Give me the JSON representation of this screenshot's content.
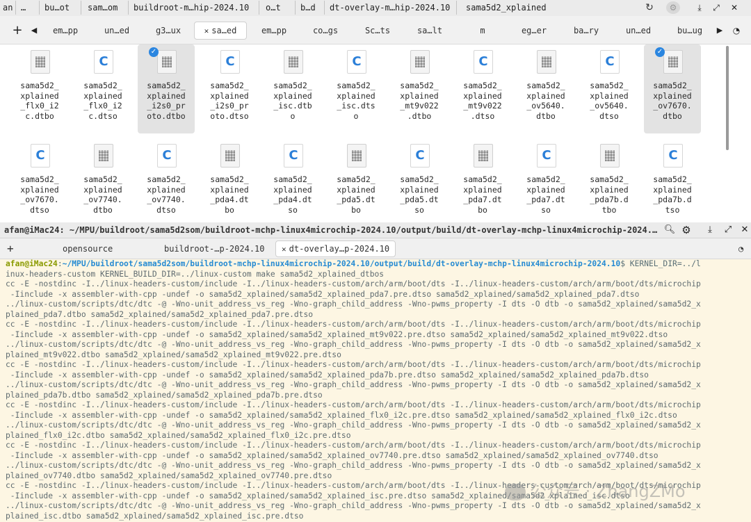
{
  "file_manager": {
    "breadcrumbs": [
      "an",
      "…",
      "bu…ot",
      "sam…om",
      "buildroot-m…hip-2024.10",
      "o…t",
      "b…d",
      "dt-overlay-m…hip-2024.10",
      "sama5d2_xplained"
    ],
    "tabs": [
      "em…pp",
      "un…ed",
      "g3…ux",
      "sa…ed",
      "em…pp",
      "co…gs",
      "Sc…ts",
      "sa…lt",
      "m",
      "eg…er",
      "ba…ry",
      "un…ed",
      "bu…ug"
    ],
    "active_tab_index": 3,
    "files": [
      {
        "name": "sama5d2_\nxplained\n_flx0_i2\nc.dtbo",
        "type": "binary",
        "selected": false
      },
      {
        "name": "sama5d2_\nxplained\n_flx0_i2\nc.dtso",
        "type": "source",
        "selected": false
      },
      {
        "name": "sama5d2_\nxplained\n_i2s0_pr\noto.dtbo",
        "type": "binary",
        "selected": true
      },
      {
        "name": "sama5d2_\nxplained\n_i2s0_pr\noto.dtso",
        "type": "source",
        "selected": false
      },
      {
        "name": "sama5d2_\nxplained\n_isc.dtb\no",
        "type": "binary",
        "selected": false
      },
      {
        "name": "sama5d2_\nxplained\n_isc.dts\no",
        "type": "source",
        "selected": false
      },
      {
        "name": "sama5d2_\nxplained\n_mt9v022\n.dtbo",
        "type": "binary",
        "selected": false
      },
      {
        "name": "sama5d2_\nxplained\n_mt9v022\n.dtso",
        "type": "source",
        "selected": false
      },
      {
        "name": "sama5d2_\nxplained\n_ov5640.\ndtbo",
        "type": "binary",
        "selected": false
      },
      {
        "name": "sama5d2_\nxplained\n_ov5640.\ndtso",
        "type": "source",
        "selected": false
      },
      {
        "name": "sama5d2_\nxplained\n_ov7670.\ndtbo",
        "type": "binary",
        "selected": true
      },
      {
        "name": "sama5d2_\nxplained\n_ov7670.\ndtso",
        "type": "source",
        "selected": false
      },
      {
        "name": "sama5d2_\nxplained\n_ov7740.\ndtbo",
        "type": "binary",
        "selected": false
      },
      {
        "name": "sama5d2_\nxplained\n_ov7740.\ndtso",
        "type": "source",
        "selected": false
      },
      {
        "name": "sama5d2_\nxplained\n_pda4.dt\nbo",
        "type": "binary",
        "selected": false
      },
      {
        "name": "sama5d2_\nxplained\n_pda4.dt\nso",
        "type": "source",
        "selected": false
      },
      {
        "name": "sama5d2_\nxplained\n_pda5.dt\nbo",
        "type": "binary",
        "selected": false
      },
      {
        "name": "sama5d2_\nxplained\n_pda5.dt\nso",
        "type": "source",
        "selected": false
      },
      {
        "name": "sama5d2_\nxplained\n_pda7.dt\nbo",
        "type": "binary",
        "selected": false
      },
      {
        "name": "sama5d2_\nxplained\n_pda7.dt\nso",
        "type": "source",
        "selected": false
      },
      {
        "name": "sama5d2_\nxplained\n_pda7b.d\ntbo",
        "type": "binary",
        "selected": false
      },
      {
        "name": "sama5d2_\nxplained\n_pda7b.d\ntso",
        "type": "source",
        "selected": false
      }
    ]
  },
  "terminal": {
    "title": "afan@iMac24: ~/MPU/buildroot/sama5d2som/buildroot-mchp-linux4microchip-2024.10/output/build/dt-overlay-mchp-linux4microchip-2024.…",
    "tabs": [
      "opensource",
      "buildroot-…p-2024.10",
      "dt-overlay…p-2024.10"
    ],
    "active_tab_index": 2,
    "prompt_user": "afan@iMac24",
    "prompt_path": "~/MPU/buildroot/sama5d2som/buildroot-mchp-linux4microchip-2024.10/output/build/dt-overlay-mchp-linux4microchip-2024.10",
    "prompt_symbol": "$ KERNEL_DIR=../l",
    "lines": [
      "inux-headers-custom KERNEL_BUILD_DIR=../linux-custom make sama5d2_xplained_dtbos",
      "cc -E -nostdinc -I../linux-headers-custom/include -I../linux-headers-custom/arch/arm/boot/dts -I../linux-headers-custom/arch/arm/boot/dts/microchip",
      " -Iinclude -x assembler-with-cpp -undef -o sama5d2_xplained/sama5d2_xplained_pda7.pre.dtso sama5d2_xplained/sama5d2_xplained_pda7.dtso",
      "../linux-custom/scripts/dtc/dtc -@ -Wno-unit_address_vs_reg -Wno-graph_child_address -Wno-pwms_property -I dts -O dtb -o sama5d2_xplained/sama5d2_x",
      "plained_pda7.dtbo sama5d2_xplained/sama5d2_xplained_pda7.pre.dtso",
      "cc -E -nostdinc -I../linux-headers-custom/include -I../linux-headers-custom/arch/arm/boot/dts -I../linux-headers-custom/arch/arm/boot/dts/microchip",
      " -Iinclude -x assembler-with-cpp -undef -o sama5d2_xplained/sama5d2_xplained_mt9v022.pre.dtso sama5d2_xplained/sama5d2_xplained_mt9v022.dtso",
      "../linux-custom/scripts/dtc/dtc -@ -Wno-unit_address_vs_reg -Wno-graph_child_address -Wno-pwms_property -I dts -O dtb -o sama5d2_xplained/sama5d2_x",
      "plained_mt9v022.dtbo sama5d2_xplained/sama5d2_xplained_mt9v022.pre.dtso",
      "cc -E -nostdinc -I../linux-headers-custom/include -I../linux-headers-custom/arch/arm/boot/dts -I../linux-headers-custom/arch/arm/boot/dts/microchip",
      " -Iinclude -x assembler-with-cpp -undef -o sama5d2_xplained/sama5d2_xplained_pda7b.pre.dtso sama5d2_xplained/sama5d2_xplained_pda7b.dtso",
      "../linux-custom/scripts/dtc/dtc -@ -Wno-unit_address_vs_reg -Wno-graph_child_address -Wno-pwms_property -I dts -O dtb -o sama5d2_xplained/sama5d2_x",
      "plained_pda7b.dtbo sama5d2_xplained/sama5d2_xplained_pda7b.pre.dtso",
      "cc -E -nostdinc -I../linux-headers-custom/include -I../linux-headers-custom/arch/arm/boot/dts -I../linux-headers-custom/arch/arm/boot/dts/microchip",
      " -Iinclude -x assembler-with-cpp -undef -o sama5d2_xplained/sama5d2_xplained_flx0_i2c.pre.dtso sama5d2_xplained/sama5d2_xplained_flx0_i2c.dtso",
      "../linux-custom/scripts/dtc/dtc -@ -Wno-unit_address_vs_reg -Wno-graph_child_address -Wno-pwms_property -I dts -O dtb -o sama5d2_xplained/sama5d2_x",
      "plained_flx0_i2c.dtbo sama5d2_xplained/sama5d2_xplained_flx0_i2c.pre.dtso",
      "cc -E -nostdinc -I../linux-headers-custom/include -I../linux-headers-custom/arch/arm/boot/dts -I../linux-headers-custom/arch/arm/boot/dts/microchip",
      " -Iinclude -x assembler-with-cpp -undef -o sama5d2_xplained/sama5d2_xplained_ov7740.pre.dtso sama5d2_xplained/sama5d2_xplained_ov7740.dtso",
      "../linux-custom/scripts/dtc/dtc -@ -Wno-unit_address_vs_reg -Wno-graph_child_address -Wno-pwms_property -I dts -O dtb -o sama5d2_xplained/sama5d2_x",
      "plained_ov7740.dtbo sama5d2_xplained/sama5d2_xplained_ov7740.pre.dtso",
      "cc -E -nostdinc -I../linux-headers-custom/include -I../linux-headers-custom/arch/arm/boot/dts -I../linux-headers-custom/arch/arm/boot/dts/microchip",
      " -Iinclude -x assembler-with-cpp -undef -o sama5d2_xplained/sama5d2_xplained_isc.pre.dtso sama5d2_xplained/sama5d2_xplained_isc.dtso",
      "../linux-custom/scripts/dtc/dtc -@ -Wno-unit_address_vs_reg -Wno-graph_child_address -Wno-pwms_property -I dts -O dtb -o sama5d2_xplained/sama5d2_x",
      "plained_isc.dtbo sama5d2_xplained/sama5d2_xplained_isc.pre.dtso"
    ]
  },
  "watermark": "公众号 · ZhangZMo"
}
